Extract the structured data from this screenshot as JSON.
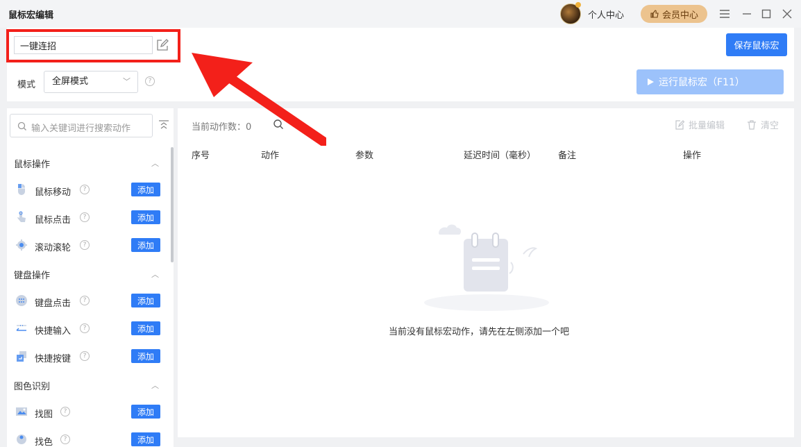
{
  "window": {
    "title": "鼠标宏编辑",
    "personal_center": "个人中心",
    "vip_center": "会员中心"
  },
  "macro": {
    "name": "一键连招",
    "save_label": "保存鼠标宏",
    "mode_label": "模式",
    "mode_value": "全屏模式",
    "run_label": "运行鼠标宏（F11）"
  },
  "sidebar": {
    "search_placeholder": "输入关键词进行搜索动作",
    "add_label": "添加",
    "sections": [
      {
        "title": "鼠标操作",
        "items": [
          "鼠标移动",
          "鼠标点击",
          "滚动滚轮"
        ]
      },
      {
        "title": "键盘操作",
        "items": [
          "键盘点击",
          "快捷输入",
          "快捷按键"
        ]
      },
      {
        "title": "图色识别",
        "items": [
          "找图",
          "找色"
        ]
      }
    ]
  },
  "main": {
    "count_label": "当前动作数：",
    "count_value": "0",
    "batch_edit": "批量编辑",
    "clear": "清空",
    "columns": [
      "序号",
      "动作",
      "参数",
      "延迟时间（毫秒）",
      "备注",
      "操作"
    ],
    "empty_text": "当前没有鼠标宏动作，请先在左侧添加一个吧"
  },
  "colors": {
    "accent": "#2f7cf6",
    "run_disabled": "#9cc2fb",
    "vip": "#ecc38e",
    "annotation_red": "#f3201a"
  }
}
